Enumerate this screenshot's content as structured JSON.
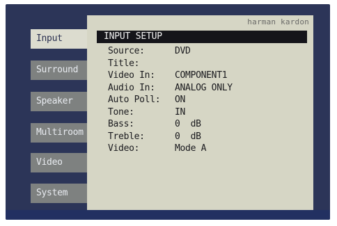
{
  "side_menu": {
    "items": [
      {
        "label": "Input",
        "active": true
      },
      {
        "label": "Surround",
        "active": false
      },
      {
        "label": "Speaker",
        "active": false
      },
      {
        "label": "Multiroom",
        "active": false
      },
      {
        "label": "Video",
        "active": false
      },
      {
        "label": "System",
        "active": false
      }
    ]
  },
  "panel": {
    "brand": "harman kardon",
    "title": "INPUT SETUP",
    "rows": [
      {
        "label": "Source:",
        "value": "DVD"
      },
      {
        "label": "Title:",
        "value": ""
      },
      {
        "label": "Video In:",
        "value": "COMPONENT1"
      },
      {
        "label": "Audio In:",
        "value": "ANALOG ONLY"
      },
      {
        "label": "Auto Poll:",
        "value": "ON"
      },
      {
        "label": "Tone:",
        "value": "IN"
      },
      {
        "label": "Bass:",
        "value": "0  dB"
      },
      {
        "label": "Treble:",
        "value": "0  dB"
      },
      {
        "label": "Video:",
        "value": "Mode A"
      }
    ]
  },
  "colors": {
    "screen_bg": "#2c3558",
    "panel_bg": "#d6d6c5",
    "menu_item_bg": "#7e8180",
    "menu_item_active_bg": "#dcdccf",
    "title_bar_bg": "#15151a"
  }
}
